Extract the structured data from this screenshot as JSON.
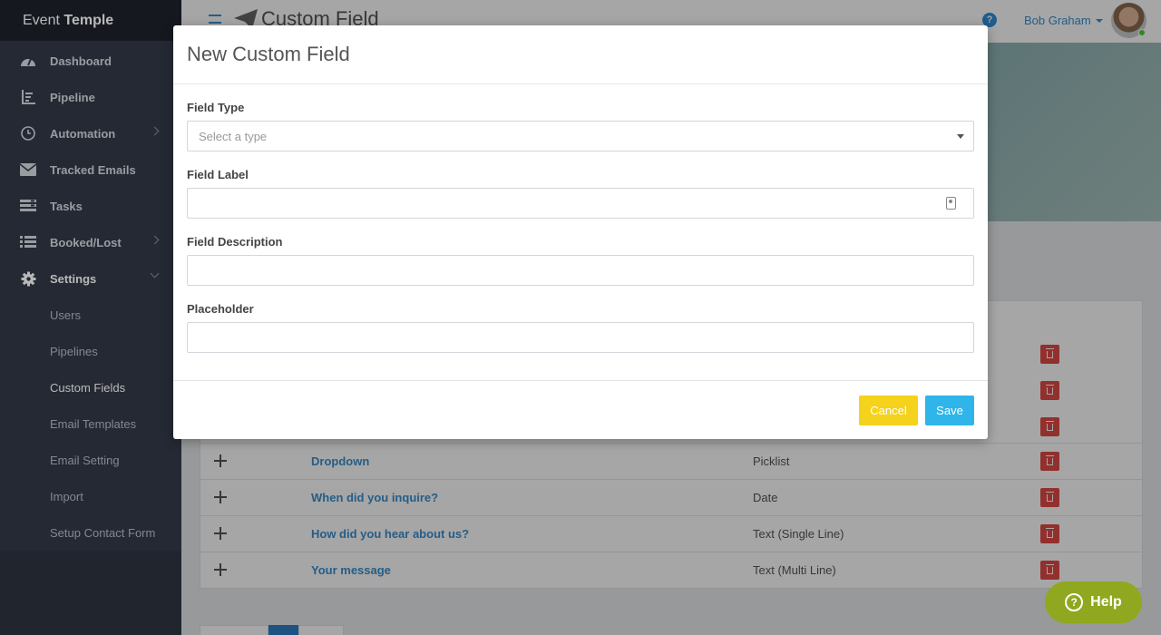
{
  "brand": {
    "light": "Event ",
    "bold": "Temple"
  },
  "sidebar": {
    "items": [
      {
        "label": "Dashboard",
        "icon": "dashboard-icon"
      },
      {
        "label": "Pipeline",
        "icon": "pipeline-icon"
      },
      {
        "label": "Automation",
        "icon": "clock-icon"
      },
      {
        "label": "Tracked Emails",
        "icon": "envelope-icon"
      },
      {
        "label": "Tasks",
        "icon": "tasks-icon"
      },
      {
        "label": "Booked/Lost",
        "icon": "list-icon"
      },
      {
        "label": "Settings",
        "icon": "gear-icon"
      }
    ],
    "settings_sub": [
      "Users",
      "Pipelines",
      "Custom Fields",
      "Email Templates",
      "Email Setting",
      "Import",
      "Setup Contact Form"
    ]
  },
  "header": {
    "title": "Custom Field",
    "user_name": "Bob Graham",
    "help_glyph": "?"
  },
  "table": {
    "rows": [
      {
        "name": "Dropdown",
        "type": "Picklist"
      },
      {
        "name": "When did you inquire?",
        "type": "Date"
      },
      {
        "name": "How did you hear about us?",
        "type": "Text (Single Line)"
      },
      {
        "name": "Your message",
        "type": "Text (Multi Line)"
      }
    ]
  },
  "help_button": {
    "label": "Help",
    "glyph": "?"
  },
  "modal": {
    "title": "New Custom Field",
    "field_type_label": "Field Type",
    "field_type_placeholder": "Select a type",
    "field_label_label": "Field Label",
    "field_description_label": "Field Description",
    "placeholder_label": "Placeholder",
    "cancel": "Cancel",
    "save": "Save"
  },
  "colors": {
    "sidebar_bg": "#343a48",
    "link_blue": "#3a8fd0",
    "cancel_yellow": "#f5d21b",
    "save_blue": "#2fb5e9",
    "delete_red": "#e14b47",
    "help_green": "#8fa81f"
  }
}
